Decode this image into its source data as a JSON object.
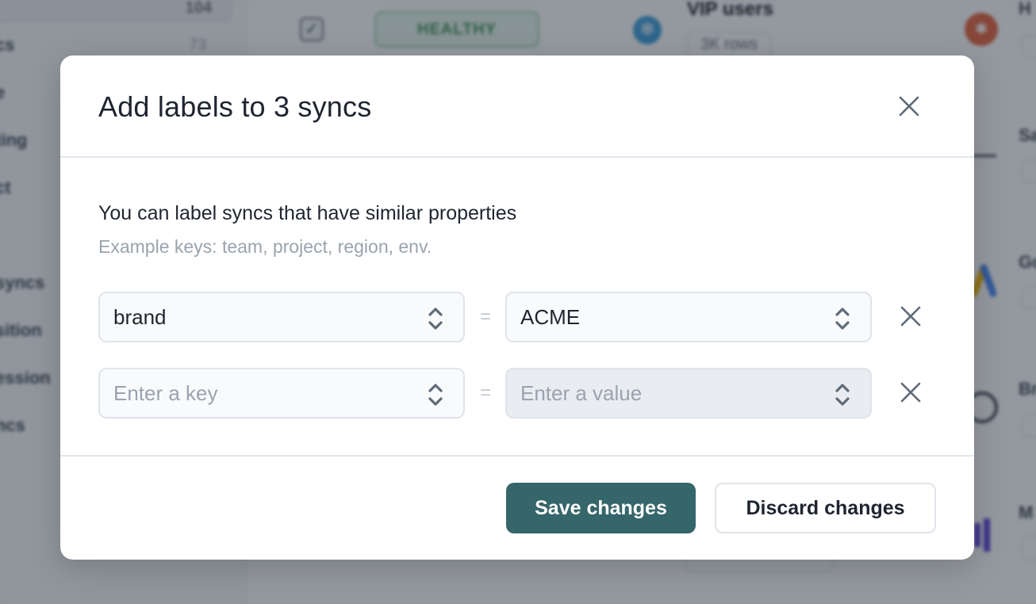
{
  "background": {
    "sidebar": {
      "active_count": "104",
      "items": [
        {
          "label": "cs",
          "count": "73"
        },
        {
          "label": "e",
          "count": ""
        },
        {
          "label": "ting",
          "count": ""
        },
        {
          "label": "ct",
          "count": ""
        },
        {
          "label": "syncs",
          "count": ""
        },
        {
          "label": "sition",
          "count": ""
        },
        {
          "label": "ession",
          "count": ""
        },
        {
          "label": "ncs",
          "count": ""
        }
      ]
    },
    "sync_row": {
      "status_badge": "HEALTHY",
      "model_name": "VIP users",
      "row_count": "3K rows"
    },
    "right_column_titles": [
      "H",
      "Sa",
      "Go",
      "Br",
      "M"
    ]
  },
  "modal": {
    "title": "Add labels to 3 syncs",
    "close_label": "Close",
    "heading": "You can label syncs that have similar properties",
    "subheading": "Example keys: team, project, region, env.",
    "equals_sign": "=",
    "rows": [
      {
        "key": "brand",
        "key_placeholder": "Enter a key",
        "value": "ACME",
        "value_placeholder": "Enter a value",
        "value_disabled": false
      },
      {
        "key": "",
        "key_placeholder": "Enter a key",
        "value": "",
        "value_placeholder": "Enter a value",
        "value_disabled": true
      }
    ],
    "save_label": "Save changes",
    "discard_label": "Discard changes"
  },
  "colors": {
    "primary": "#35666a",
    "text": "#1f2530",
    "muted": "#9aa3af",
    "border": "#dfe4ea",
    "healthy": "#3f8f55"
  }
}
